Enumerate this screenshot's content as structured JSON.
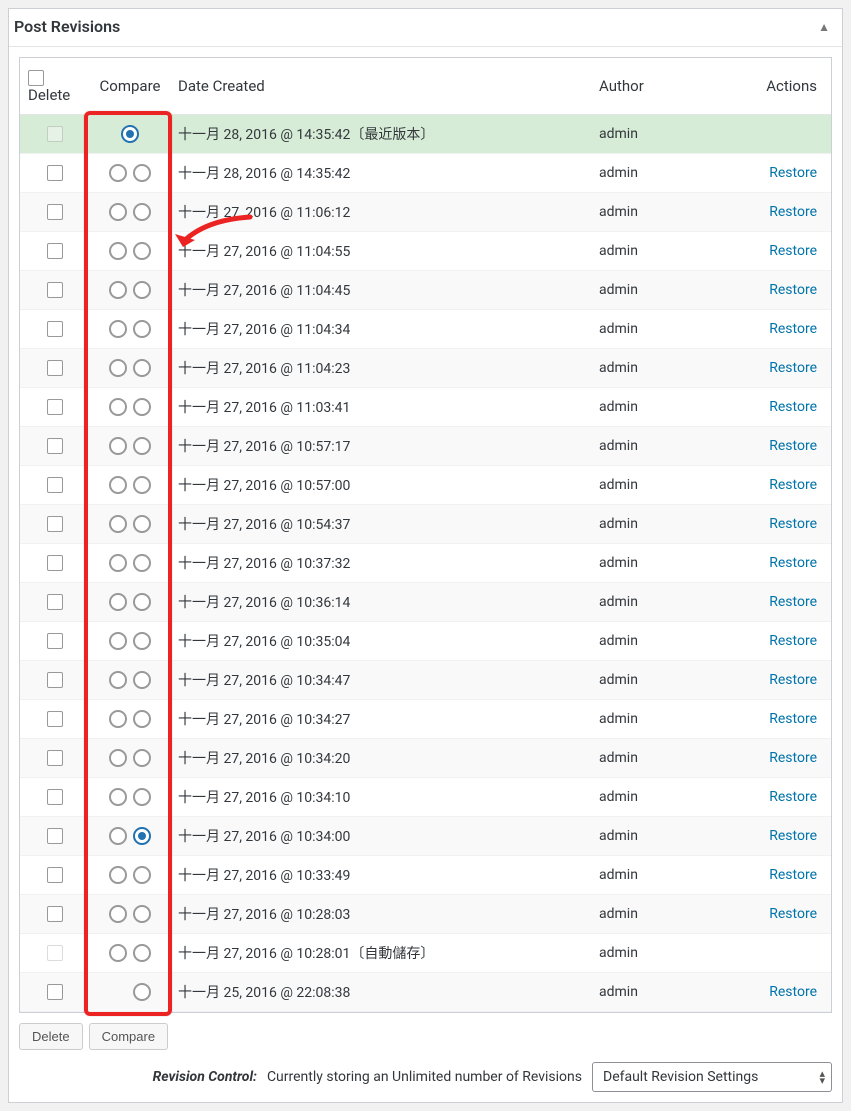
{
  "panel_title": "Post Revisions",
  "toggle_glyph": "▲",
  "headers": {
    "delete": "Delete",
    "compare": "Compare",
    "date": "Date Created",
    "author": "Author",
    "actions": "Actions"
  },
  "action_label": "Restore",
  "buttons": {
    "delete": "Delete",
    "compare": "Compare"
  },
  "footer": {
    "label": "Revision Control:",
    "text": "Currently storing an Unlimited number of Revisions",
    "select": "Default Revision Settings"
  },
  "rows": [
    {
      "date": "十一月 28, 2016 @ 14:35:42",
      "suffix": "〔最近版本〕",
      "author": "admin",
      "current": true,
      "delete_dim": true,
      "left": true,
      "right": false,
      "left_checked": true,
      "right_checked": false,
      "restore": false
    },
    {
      "date": "十一月 28, 2016 @ 14:35:42",
      "suffix": "",
      "author": "admin",
      "current": false,
      "delete_dim": false,
      "left": true,
      "right": true,
      "left_checked": false,
      "right_checked": false,
      "restore": true
    },
    {
      "date": "十一月 27, 2016 @ 11:06:12",
      "suffix": "",
      "author": "admin",
      "current": false,
      "delete_dim": false,
      "left": true,
      "right": true,
      "left_checked": false,
      "right_checked": false,
      "restore": true
    },
    {
      "date": "十一月 27, 2016 @ 11:04:55",
      "suffix": "",
      "author": "admin",
      "current": false,
      "delete_dim": false,
      "left": true,
      "right": true,
      "left_checked": false,
      "right_checked": false,
      "restore": true
    },
    {
      "date": "十一月 27, 2016 @ 11:04:45",
      "suffix": "",
      "author": "admin",
      "current": false,
      "delete_dim": false,
      "left": true,
      "right": true,
      "left_checked": false,
      "right_checked": false,
      "restore": true
    },
    {
      "date": "十一月 27, 2016 @ 11:04:34",
      "suffix": "",
      "author": "admin",
      "current": false,
      "delete_dim": false,
      "left": true,
      "right": true,
      "left_checked": false,
      "right_checked": false,
      "restore": true
    },
    {
      "date": "十一月 27, 2016 @ 11:04:23",
      "suffix": "",
      "author": "admin",
      "current": false,
      "delete_dim": false,
      "left": true,
      "right": true,
      "left_checked": false,
      "right_checked": false,
      "restore": true
    },
    {
      "date": "十一月 27, 2016 @ 11:03:41",
      "suffix": "",
      "author": "admin",
      "current": false,
      "delete_dim": false,
      "left": true,
      "right": true,
      "left_checked": false,
      "right_checked": false,
      "restore": true
    },
    {
      "date": "十一月 27, 2016 @ 10:57:17",
      "suffix": "",
      "author": "admin",
      "current": false,
      "delete_dim": false,
      "left": true,
      "right": true,
      "left_checked": false,
      "right_checked": false,
      "restore": true
    },
    {
      "date": "十一月 27, 2016 @ 10:57:00",
      "suffix": "",
      "author": "admin",
      "current": false,
      "delete_dim": false,
      "left": true,
      "right": true,
      "left_checked": false,
      "right_checked": false,
      "restore": true
    },
    {
      "date": "十一月 27, 2016 @ 10:54:37",
      "suffix": "",
      "author": "admin",
      "current": false,
      "delete_dim": false,
      "left": true,
      "right": true,
      "left_checked": false,
      "right_checked": false,
      "restore": true
    },
    {
      "date": "十一月 27, 2016 @ 10:37:32",
      "suffix": "",
      "author": "admin",
      "current": false,
      "delete_dim": false,
      "left": true,
      "right": true,
      "left_checked": false,
      "right_checked": false,
      "restore": true
    },
    {
      "date": "十一月 27, 2016 @ 10:36:14",
      "suffix": "",
      "author": "admin",
      "current": false,
      "delete_dim": false,
      "left": true,
      "right": true,
      "left_checked": false,
      "right_checked": false,
      "restore": true
    },
    {
      "date": "十一月 27, 2016 @ 10:35:04",
      "suffix": "",
      "author": "admin",
      "current": false,
      "delete_dim": false,
      "left": true,
      "right": true,
      "left_checked": false,
      "right_checked": false,
      "restore": true
    },
    {
      "date": "十一月 27, 2016 @ 10:34:47",
      "suffix": "",
      "author": "admin",
      "current": false,
      "delete_dim": false,
      "left": true,
      "right": true,
      "left_checked": false,
      "right_checked": false,
      "restore": true
    },
    {
      "date": "十一月 27, 2016 @ 10:34:27",
      "suffix": "",
      "author": "admin",
      "current": false,
      "delete_dim": false,
      "left": true,
      "right": true,
      "left_checked": false,
      "right_checked": false,
      "restore": true
    },
    {
      "date": "十一月 27, 2016 @ 10:34:20",
      "suffix": "",
      "author": "admin",
      "current": false,
      "delete_dim": false,
      "left": true,
      "right": true,
      "left_checked": false,
      "right_checked": false,
      "restore": true
    },
    {
      "date": "十一月 27, 2016 @ 10:34:10",
      "suffix": "",
      "author": "admin",
      "current": false,
      "delete_dim": false,
      "left": true,
      "right": true,
      "left_checked": false,
      "right_checked": false,
      "restore": true
    },
    {
      "date": "十一月 27, 2016 @ 10:34:00",
      "suffix": "",
      "author": "admin",
      "current": false,
      "delete_dim": false,
      "left": true,
      "right": true,
      "left_checked": false,
      "right_checked": true,
      "restore": true
    },
    {
      "date": "十一月 27, 2016 @ 10:33:49",
      "suffix": "",
      "author": "admin",
      "current": false,
      "delete_dim": false,
      "left": true,
      "right": true,
      "left_checked": false,
      "right_checked": false,
      "restore": true
    },
    {
      "date": "十一月 27, 2016 @ 10:28:03",
      "suffix": "",
      "author": "admin",
      "current": false,
      "delete_dim": false,
      "left": true,
      "right": true,
      "left_checked": false,
      "right_checked": false,
      "restore": true
    },
    {
      "date": "十一月 27, 2016 @ 10:28:01",
      "suffix": "〔自動儲存〕",
      "author": "admin",
      "current": false,
      "delete_dim": true,
      "left": true,
      "right": true,
      "left_checked": false,
      "right_checked": false,
      "restore": false
    },
    {
      "date": "十一月 25, 2016 @ 22:08:38",
      "suffix": "",
      "author": "admin",
      "current": false,
      "delete_dim": false,
      "left": false,
      "right": true,
      "left_checked": false,
      "right_checked": false,
      "restore": true
    }
  ]
}
